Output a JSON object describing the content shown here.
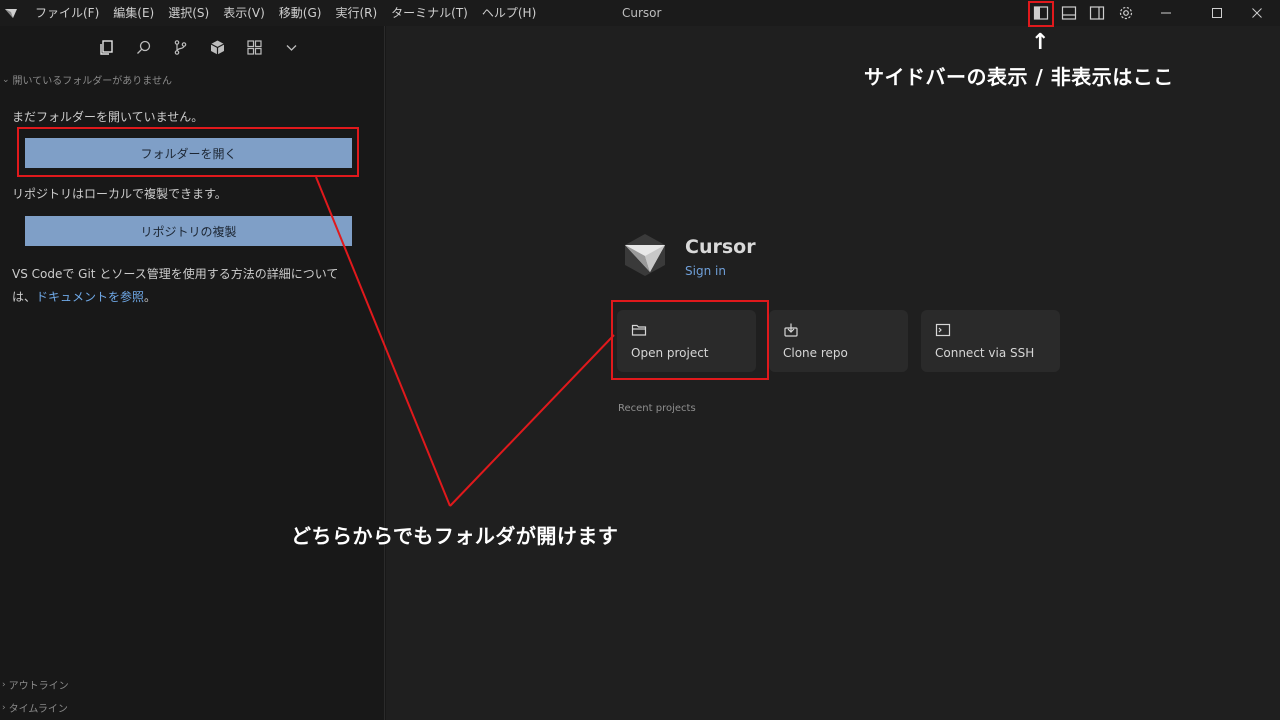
{
  "titlebar": {
    "menu": [
      "ファイル(F)",
      "編集(E)",
      "選択(S)",
      "表示(V)",
      "移動(G)",
      "実行(R)",
      "ターミナル(T)",
      "ヘルプ(H)"
    ],
    "title": "Cursor",
    "icons": [
      "toggle-primary-sidebar-icon",
      "toggle-panel-icon",
      "toggle-secondary-sidebar-icon",
      "gear-icon"
    ],
    "window_controls": [
      "minimize-icon",
      "maximize-icon",
      "close-icon"
    ]
  },
  "sidebar": {
    "activity_icons": [
      "explorer-icon",
      "search-icon",
      "source-control-icon",
      "extensions-icon",
      "grid-icon",
      "chevron-down-icon"
    ],
    "section_header": "開いているフォルダーがありません",
    "no_folder_text": "まだフォルダーを開いていません。",
    "open_folder_button": "フォルダーを開く",
    "clone_hint": "リポジトリはローカルで複製できます。",
    "clone_button": "リポジトリの複製",
    "doc_text_1": "VS Codeで Git とソース管理を使用する方法の詳細については、",
    "doc_link": "ドキュメントを参照",
    "doc_text_2": "。",
    "outline_label": "アウトライン",
    "timeline_label": "タイムライン"
  },
  "main": {
    "app_name": "Cursor",
    "sign_in": "Sign in",
    "cards": [
      {
        "label": "Open project",
        "icon": "folder-icon"
      },
      {
        "label": "Clone repo",
        "icon": "clone-icon"
      },
      {
        "label": "Connect via SSH",
        "icon": "terminal-icon"
      }
    ],
    "recent_projects": "Recent projects"
  },
  "annotations": {
    "sidebar_toggle_arrow": "↑",
    "sidebar_toggle_note": "サイドバーの表示 / 非表示はここ",
    "open_folder_note": "どちらからでもフォルダが開けます"
  },
  "colors": {
    "annotation_red": "#e0191c",
    "button_blue": "#7f9fc7",
    "link_blue": "#6fa8e6"
  }
}
